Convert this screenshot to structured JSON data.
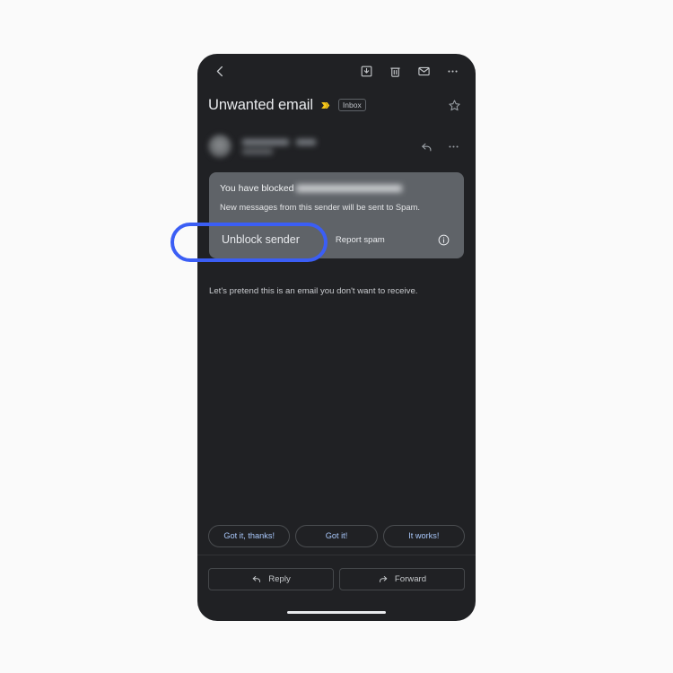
{
  "page": {
    "background_color": "#fafafa",
    "device_background": "#202124"
  },
  "toolbar": {
    "back_label": "Back",
    "icons": [
      {
        "name": "archive-icon",
        "label": "Archive"
      },
      {
        "name": "delete-icon",
        "label": "Delete"
      },
      {
        "name": "mark-unread-icon",
        "label": "Mark as unread"
      },
      {
        "name": "overflow-menu-icon",
        "label": "More options"
      }
    ]
  },
  "email": {
    "subject": "Unwanted email",
    "important_marker": "important-marker",
    "label": "Inbox",
    "starred": false,
    "star_label": "Star",
    "sender_redacted": true,
    "body": "Let's pretend this is an email you don't want to receive."
  },
  "blocked_card": {
    "title_prefix": "You have blocked",
    "blocked_address_redacted": true,
    "subtitle": "New messages from this sender will be sent to Spam.",
    "unblock_label": "Unblock sender",
    "report_label": "Report spam",
    "info_label": "More info",
    "background_color": "#5f6368"
  },
  "highlight": {
    "target": "Unblock sender",
    "color": "#3b5ef5",
    "shape": "ellipse-ring"
  },
  "smart_replies": [
    "Got it, thanks!",
    "Got it!",
    "It works!"
  ],
  "reply_bar": {
    "reply_label": "Reply",
    "forward_label": "Forward"
  }
}
